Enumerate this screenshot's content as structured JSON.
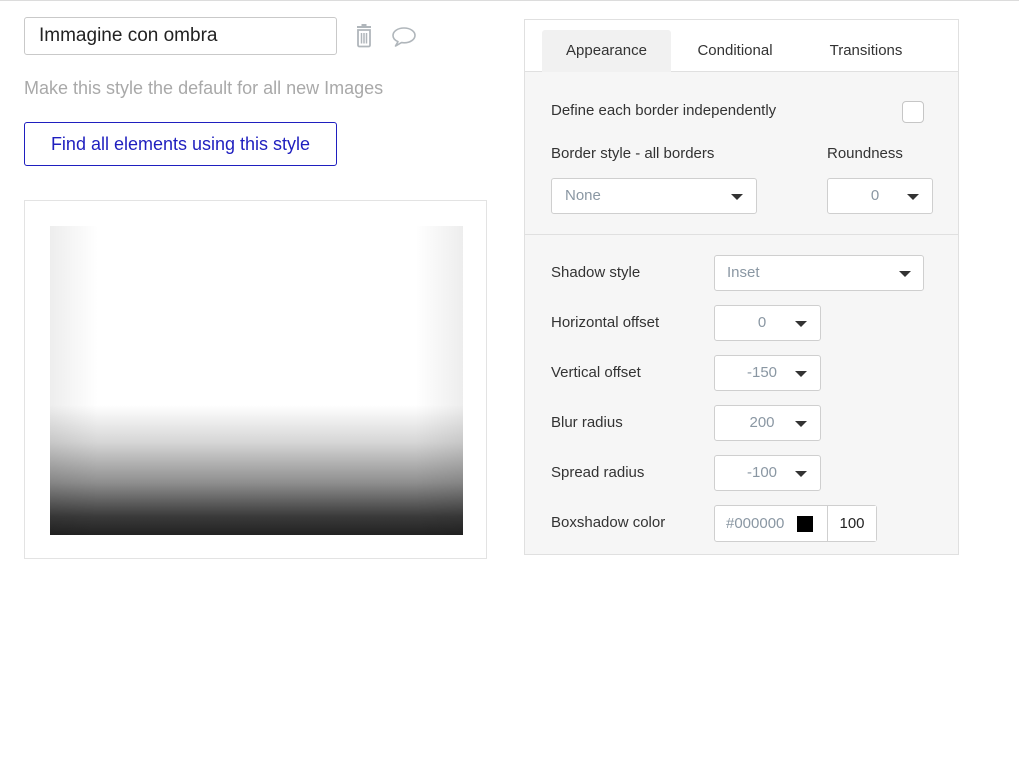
{
  "style_name": "Immagine con ombra",
  "icons": {
    "delete": "trash-icon",
    "comment": "comment-icon"
  },
  "default_link": "Make this style the default for all new Images",
  "find_button": "Find all elements using this style",
  "tabs": [
    {
      "label": "Appearance",
      "active": true
    },
    {
      "label": "Conditional",
      "active": false
    },
    {
      "label": "Transitions",
      "active": false
    }
  ],
  "border": {
    "independent_label": "Define each border independently",
    "independent_checked": false,
    "style_label": "Border style - all borders",
    "style_value": "None",
    "roundness_label": "Roundness",
    "roundness_value": "0"
  },
  "shadow": {
    "style_label": "Shadow style",
    "style_value": "Inset",
    "horizontal_label": "Horizontal offset",
    "horizontal_value": "0",
    "vertical_label": "Vertical offset",
    "vertical_value": "-150",
    "blur_label": "Blur radius",
    "blur_value": "200",
    "spread_label": "Spread radius",
    "spread_value": "-100",
    "color_label": "Boxshadow color",
    "color_value": "#000000",
    "opacity_value": "100"
  },
  "colors": {
    "accent": "#1f1fbf",
    "swatch": "#000000"
  }
}
